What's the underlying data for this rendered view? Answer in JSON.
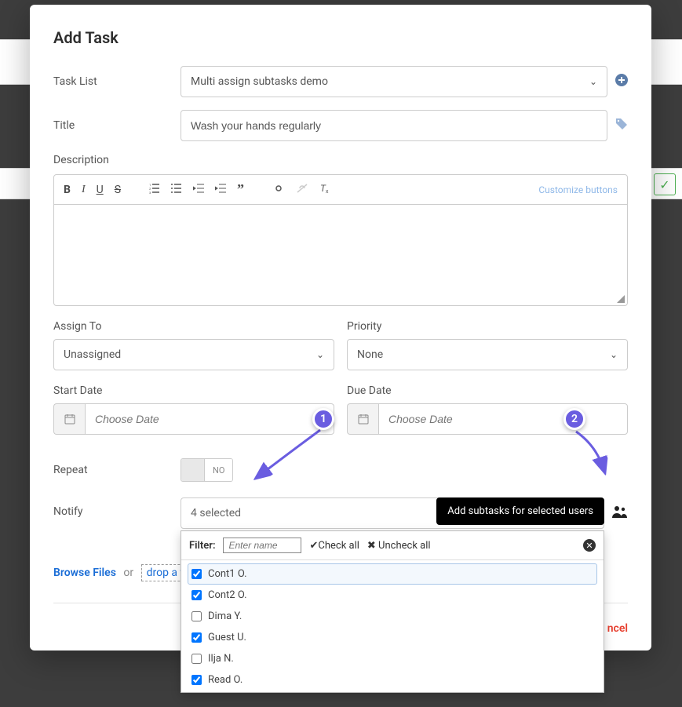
{
  "modal_title": "Add Task",
  "labels": {
    "task_list": "Task List",
    "title": "Title",
    "description": "Description",
    "assign_to": "Assign To",
    "priority": "Priority",
    "start_date": "Start Date",
    "due_date": "Due Date",
    "repeat": "Repeat",
    "notify": "Notify"
  },
  "task_list_value": "Multi assign subtasks demo",
  "title_value": "Wash your hands regularly",
  "assign_value": "Unassigned",
  "priority_value": "None",
  "date_placeholder": "Choose Date",
  "repeat_value": "NO",
  "notify_summary": "4 selected",
  "customize": "Customize buttons",
  "dropdown": {
    "filter_label": "Filter:",
    "filter_placeholder": "Enter name",
    "check_all": "Check all",
    "uncheck_all": "Uncheck all",
    "items": [
      {
        "label": "Cont1 O.",
        "checked": true,
        "hl": true
      },
      {
        "label": "Cont2 O.",
        "checked": true,
        "hl": false
      },
      {
        "label": "Dima Y.",
        "checked": false,
        "hl": false
      },
      {
        "label": "Guest U.",
        "checked": true,
        "hl": false
      },
      {
        "label": "Ilja N.",
        "checked": false,
        "hl": false
      },
      {
        "label": "Read O.",
        "checked": true,
        "hl": false
      }
    ]
  },
  "tooltip": "Add subtasks for selected users",
  "browse": {
    "browse": "Browse Files",
    "or": "or",
    "drop": "drop a file"
  },
  "cancel": "ncel",
  "callouts": {
    "one": "1",
    "two": "2"
  }
}
